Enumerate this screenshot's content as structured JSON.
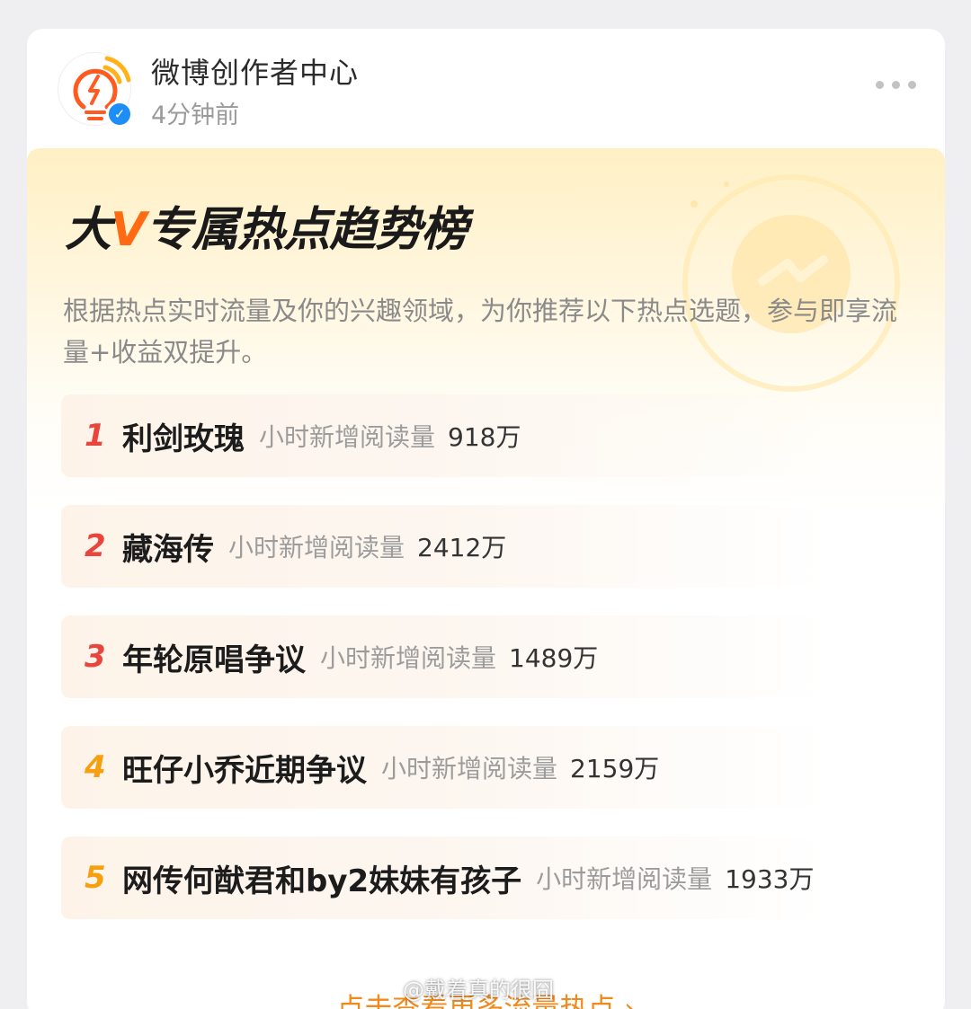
{
  "post": {
    "author": "微博创作者中心",
    "time_ago": "4分钟前",
    "verified_icon": "verified-badge-icon",
    "more_icon": "more-dots-icon"
  },
  "banner": {
    "headline_pre": "大",
    "headline_v": "V",
    "headline_post": "专属热点趋势榜",
    "description": "根据热点实时流量及你的兴趣领域，为你推荐以下热点选题，参与即享流量+收益双提升。",
    "cta": "点击查看更多流量热点 ›"
  },
  "trends": [
    {
      "rank": "1",
      "topic": "利剑玫瑰",
      "metric": "小时新增阅读量",
      "value": "918万"
    },
    {
      "rank": "2",
      "topic": "藏海传",
      "metric": "小时新增阅读量",
      "value": "2412万"
    },
    {
      "rank": "3",
      "topic": "年轮原唱争议",
      "metric": "小时新增阅读量",
      "value": "1489万"
    },
    {
      "rank": "4",
      "topic": "旺仔小乔近期争议",
      "metric": "小时新增阅读量",
      "value": "2159万"
    },
    {
      "rank": "5",
      "topic": "网传何猷君和by2妹妹有孩子",
      "metric": "小时新增阅读量",
      "value": "1933万"
    }
  ],
  "watermark": "@戴着真的很囧",
  "colors": {
    "accent_orange": "#ff6a13",
    "rank_red": "#e8453c",
    "rank_yellow": "#f6a00f",
    "cta": "#f08a1c"
  }
}
